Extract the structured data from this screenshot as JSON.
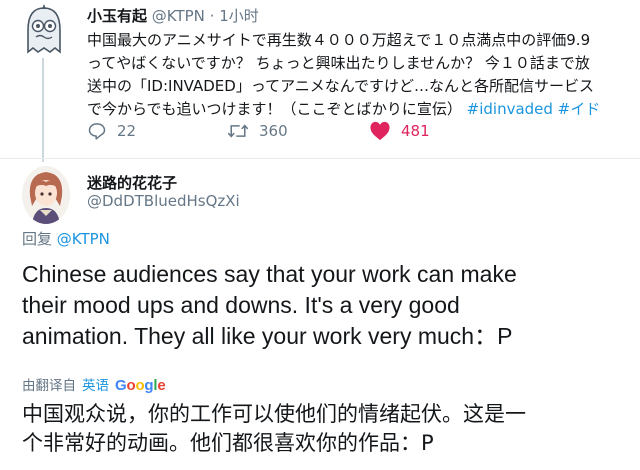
{
  "tweet": {
    "display_name": "小玉有起",
    "handle": "@KTPN",
    "separator": "·",
    "time": "1小时",
    "text_lines": [
      "中国最大のアニメサイトで再生数４０００万超えで１０点満点中の評価9.9",
      "ってやばくないですか？ ちょっと興味出たりしませんか？ 今１０話まで放",
      "送中の「ID:INVADED」ってアニメなんですけど…なんと各所配信サービス"
    ],
    "last_line_text": "で今からでも追いつけます！（ここぞとばかりに宣伝）",
    "hashtag": "#idinvaded #イド",
    "reply_count": "22",
    "retweet_count": "360",
    "like_count": "481",
    "like_color": "#e0245e"
  },
  "reply": {
    "display_name": "迷路的花花子",
    "handle": "@DdDTBluedHsQzXi",
    "replying_prefix": "回复",
    "replying_to": "@KTPN",
    "text_lines": [
      "Chinese audiences say that your work can make",
      "their mood ups and downs. It's a very good",
      "animation. They all like your work very much：P"
    ],
    "translated_by": "由翻译自",
    "translated_lang": "英语",
    "translation_lines": [
      "中国观众说，你的工作可以使他们的情绪起伏。这是一",
      "个非常好的动画。他们都很喜欢你的作品：P"
    ]
  },
  "icons": [
    "reply-icon",
    "retweet-icon",
    "heart-icon",
    "google-logo"
  ],
  "colors": {
    "link": "#1b95e0",
    "muted": "#657786",
    "text": "#14171a"
  }
}
